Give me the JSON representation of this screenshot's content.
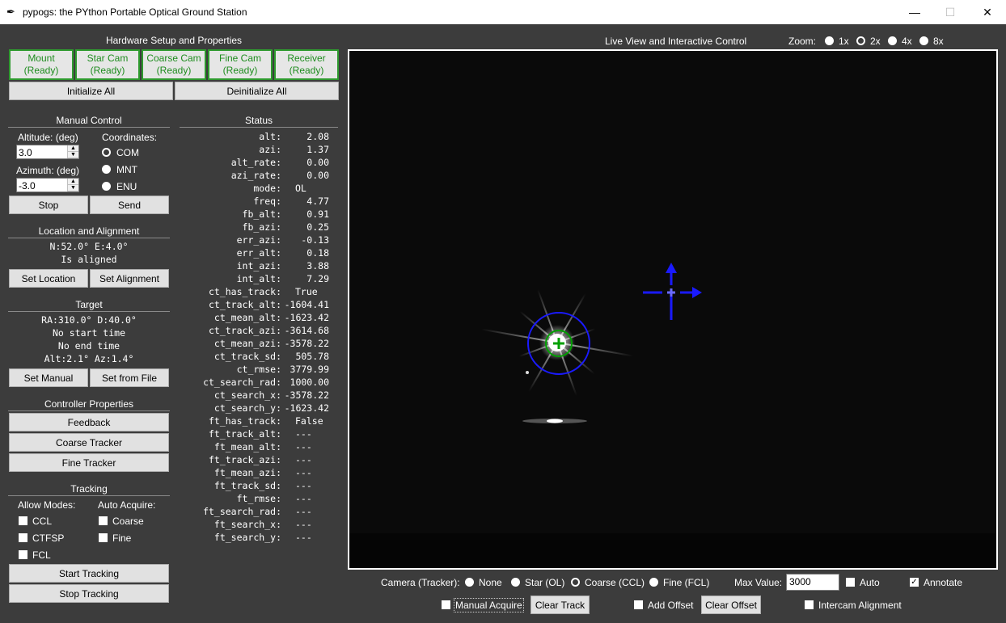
{
  "window": {
    "title": "pypogs: the PYthon Portable Optical Ground Station",
    "minimize": "—",
    "maximize": "☐",
    "close": "✕"
  },
  "hardware": {
    "title": "Hardware Setup and Properties",
    "devices": [
      {
        "name": "Mount",
        "status": "(Ready)"
      },
      {
        "name": "Star Cam",
        "status": "(Ready)"
      },
      {
        "name": "Coarse Cam",
        "status": "(Ready)"
      },
      {
        "name": "Fine Cam",
        "status": "(Ready)"
      },
      {
        "name": "Receiver",
        "status": "(Ready)"
      }
    ],
    "init_all": "Initialize All",
    "deinit_all": "Deinitialize All"
  },
  "manual": {
    "title": "Manual Control",
    "altitude_label": "Altitude: (deg)",
    "altitude_value": "3.0",
    "azimuth_label": "Azimuth: (deg)",
    "azimuth_value": "-3.0",
    "coords_label": "Coordinates:",
    "coords": [
      "COM",
      "MNT",
      "ENU"
    ],
    "coords_selected": "COM",
    "stop": "Stop",
    "send": "Send"
  },
  "location": {
    "title": "Location and Alignment",
    "coords": "N:52.0° E:4.0°",
    "aligned": "Is aligned",
    "set_location": "Set Location",
    "set_alignment": "Set Alignment"
  },
  "target": {
    "title": "Target",
    "radec": "RA:310.0° D:40.0°",
    "start": "No start time",
    "end": "No end time",
    "altaz": "Alt:2.1° Az:1.4°",
    "set_manual": "Set Manual",
    "set_file": "Set from File"
  },
  "controller": {
    "title": "Controller Properties",
    "feedback": "Feedback",
    "coarse": "Coarse Tracker",
    "fine": "Fine Tracker"
  },
  "tracking": {
    "title": "Tracking",
    "allow_label": "Allow Modes:",
    "auto_label": "Auto Acquire:",
    "modes": [
      "CCL",
      "CTFSP",
      "FCL"
    ],
    "auto": [
      "Coarse",
      "Fine"
    ],
    "start": "Start Tracking",
    "stop": "Stop Tracking"
  },
  "status": {
    "title": "Status",
    "rows": [
      {
        "key": "alt:",
        "val": "2.08"
      },
      {
        "key": "azi:",
        "val": "1.37"
      },
      {
        "key": "alt_rate:",
        "val": "0.00"
      },
      {
        "key": "azi_rate:",
        "val": "0.00"
      },
      {
        "key": "mode:",
        "val": "OL"
      },
      {
        "key": "freq:",
        "val": "4.77"
      },
      {
        "key": "fb_alt:",
        "val": "0.91"
      },
      {
        "key": "fb_azi:",
        "val": "0.25"
      },
      {
        "key": "err_azi:",
        "val": "-0.13"
      },
      {
        "key": "err_alt:",
        "val": "0.18"
      },
      {
        "key": "int_azi:",
        "val": "3.88"
      },
      {
        "key": "int_alt:",
        "val": "7.29"
      },
      {
        "key": "ct_has_track:",
        "val": "True"
      },
      {
        "key": "ct_track_alt:",
        "val": "-1604.41"
      },
      {
        "key": "ct_mean_alt:",
        "val": "-1623.42"
      },
      {
        "key": "ct_track_azi:",
        "val": "-3614.68"
      },
      {
        "key": "ct_mean_azi:",
        "val": "-3578.22"
      },
      {
        "key": "ct_track_sd:",
        "val": "505.78"
      },
      {
        "key": "ct_rmse:",
        "val": "3779.99"
      },
      {
        "key": "ct_search_rad:",
        "val": "1000.00"
      },
      {
        "key": "ct_search_x:",
        "val": "-3578.22"
      },
      {
        "key": "ct_search_y:",
        "val": "-1623.42"
      },
      {
        "key": "ft_has_track:",
        "val": "False"
      },
      {
        "key": "ft_track_alt:",
        "val": "---"
      },
      {
        "key": "ft_mean_alt:",
        "val": "---"
      },
      {
        "key": "ft_track_azi:",
        "val": "---"
      },
      {
        "key": "ft_mean_azi:",
        "val": "---"
      },
      {
        "key": "ft_track_sd:",
        "val": "---"
      },
      {
        "key": "ft_rmse:",
        "val": "---"
      },
      {
        "key": "ft_search_rad:",
        "val": "---"
      },
      {
        "key": "ft_search_x:",
        "val": "---"
      },
      {
        "key": "ft_search_y:",
        "val": "---"
      }
    ]
  },
  "live": {
    "title": "Live View and Interactive Control",
    "zoom_label": "Zoom:",
    "zoom_options": [
      "1x",
      "2x",
      "4x",
      "8x"
    ],
    "zoom_selected": "2x"
  },
  "bottom": {
    "camera_label": "Camera (Tracker):",
    "cameras": [
      "None",
      "Star (OL)",
      "Coarse (CCL)",
      "Fine (FCL)"
    ],
    "camera_selected": "Coarse (CCL)",
    "max_label": "Max Value:",
    "max_value": "3000",
    "auto": "Auto",
    "annotate": "Annotate",
    "manual_acquire": "Manual Acquire",
    "clear_track": "Clear Track",
    "add_offset": "Add Offset",
    "clear_offset": "Clear Offset",
    "intercam": "Intercam Alignment"
  },
  "colors": {
    "ready_green": "#1e8c1e",
    "track_blue": "#1a1aff",
    "track_green": "#00a000"
  }
}
